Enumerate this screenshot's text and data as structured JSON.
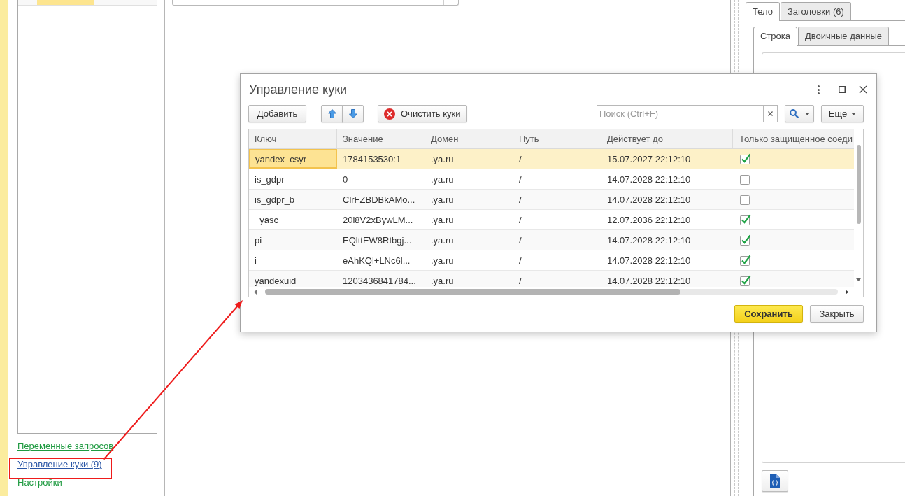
{
  "sidebar": {
    "list_rows": [
      {
        "selected": true
      }
    ],
    "links": [
      {
        "label": "Переменные запросов",
        "kind": "link"
      },
      {
        "label": "Управление куки (9)",
        "kind": "visited_link"
      },
      {
        "label": "Настройки",
        "kind": "group"
      }
    ]
  },
  "dialog": {
    "title": "Управление куки",
    "toolbar": {
      "add_label": "Добавить",
      "clear_label": "Очистить куки",
      "search": {
        "placeholder": "Поиск (Ctrl+F)"
      },
      "more_label": "Еще"
    },
    "table": {
      "columns": [
        "Ключ",
        "Значение",
        "Домен",
        "Путь",
        "Действует до",
        "Только защищенное соеди"
      ],
      "rows": [
        {
          "key": "yandex_csyr",
          "value": "1784153530:1",
          "domain": ".ya.ru",
          "path": "/",
          "expires": "15.07.2027 22:12:10",
          "checked": true,
          "selected": true
        },
        {
          "key": "is_gdpr",
          "value": "0",
          "domain": ".ya.ru",
          "path": "/",
          "expires": "14.07.2028 22:12:10",
          "checked": false,
          "selected": false
        },
        {
          "key": "is_gdpr_b",
          "value": "ClrFZBDBkAMo...",
          "domain": ".ya.ru",
          "path": "/",
          "expires": "14.07.2028 22:12:10",
          "checked": false,
          "selected": false
        },
        {
          "key": "_yasc",
          "value": "20l8V2xBywLM...",
          "domain": ".ya.ru",
          "path": "/",
          "expires": "12.07.2036 22:12:10",
          "checked": true,
          "selected": false
        },
        {
          "key": "pi",
          "value": "EQlttEW8Rtbgj...",
          "domain": ".ya.ru",
          "path": "/",
          "expires": "14.07.2028 22:12:10",
          "checked": true,
          "selected": false
        },
        {
          "key": "i",
          "value": "eAhKQl+LNc6l...",
          "domain": ".ya.ru",
          "path": "/",
          "expires": "14.07.2028 22:12:10",
          "checked": true,
          "selected": false
        },
        {
          "key": "yandexuid",
          "value": "1203436841784...",
          "domain": ".ya.ru",
          "path": "/",
          "expires": "14.07.2028 22:12:10",
          "checked": true,
          "selected": false
        }
      ]
    },
    "buttons": [
      {
        "label": "Сохранить",
        "kind": "primary"
      },
      {
        "label": "Закрыть",
        "kind": "default"
      }
    ]
  },
  "request_panel": {
    "tabs": [
      {
        "label": "Тело",
        "selected": true
      },
      {
        "label": "Заголовки (6)",
        "selected": false
      }
    ],
    "subtabs": [
      {
        "label": "Строка",
        "selected": true
      },
      {
        "label": "Двоичные данные",
        "selected": false
      }
    ]
  }
}
